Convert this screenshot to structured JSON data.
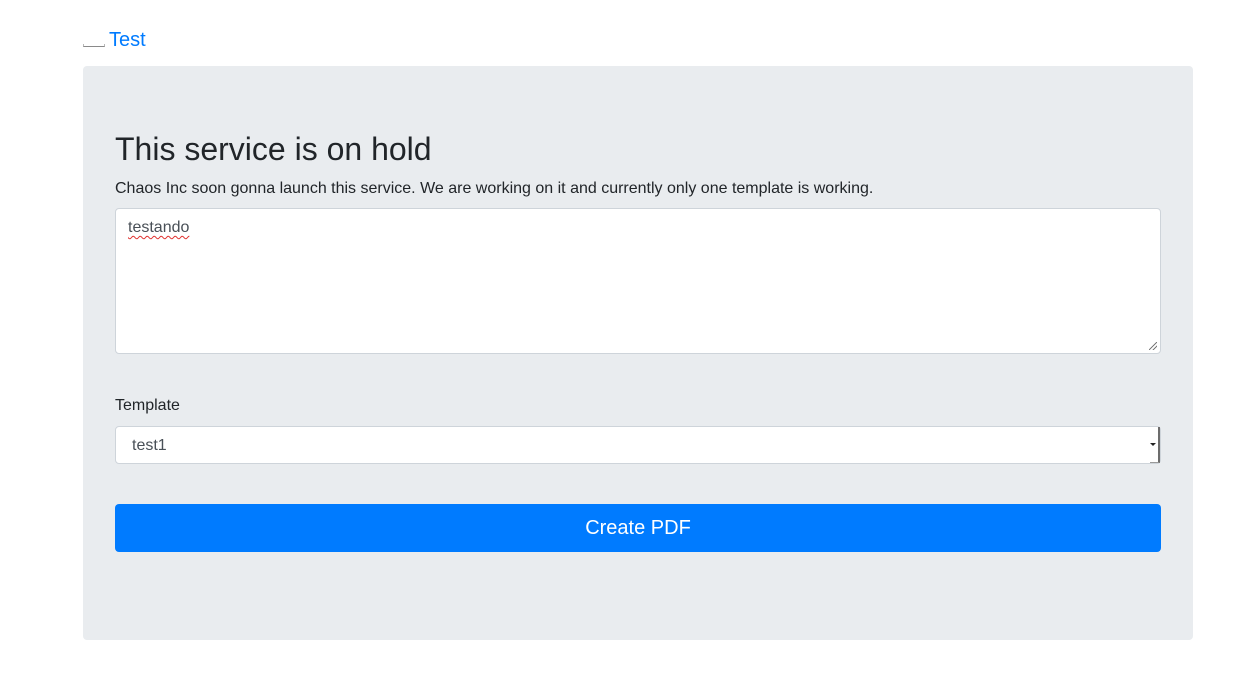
{
  "nav": {
    "brand_label": "Test",
    "brand_image_icon": "broken-image-icon"
  },
  "hero": {
    "title": "This service is on hold",
    "lead": "Chaos Inc soon gonna launch this service. We are working on it and currently only one template is working."
  },
  "form": {
    "text_value": "testando",
    "template_label": "Template",
    "template_selected": "test1",
    "submit_label": "Create PDF"
  },
  "colors": {
    "accent": "#007bff",
    "panel_background": "#e9ecef",
    "text": "#212529"
  }
}
